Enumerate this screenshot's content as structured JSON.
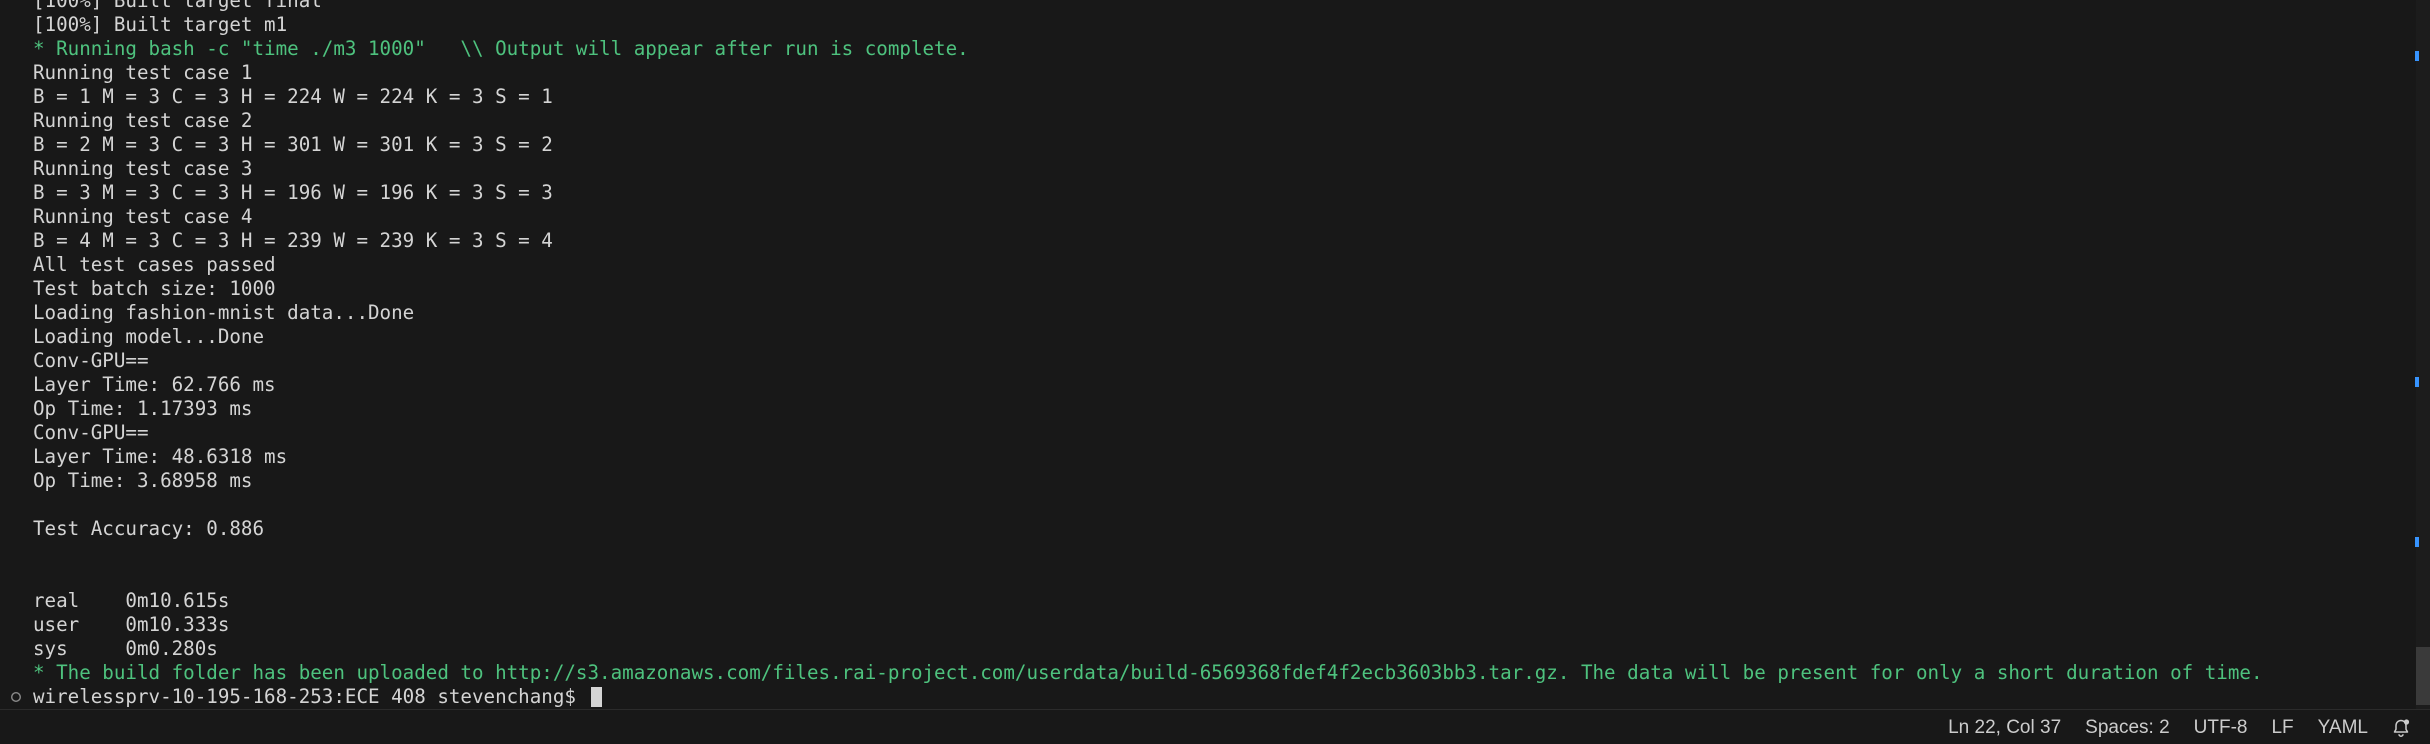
{
  "terminal": {
    "lines": [
      {
        "text": "[100%] Built target final",
        "color": "default"
      },
      {
        "text": "[100%] Built target m1",
        "color": "default"
      },
      {
        "text": "* Running bash -c \"time ./m3 1000\"   \\\\ Output will appear after run is complete.",
        "color": "green"
      },
      {
        "text": "Running test case 1",
        "color": "default"
      },
      {
        "text": "B = 1 M = 3 C = 3 H = 224 W = 224 K = 3 S = 1",
        "color": "default"
      },
      {
        "text": "Running test case 2",
        "color": "default"
      },
      {
        "text": "B = 2 M = 3 C = 3 H = 301 W = 301 K = 3 S = 2",
        "color": "default"
      },
      {
        "text": "Running test case 3",
        "color": "default"
      },
      {
        "text": "B = 3 M = 3 C = 3 H = 196 W = 196 K = 3 S = 3",
        "color": "default"
      },
      {
        "text": "Running test case 4",
        "color": "default"
      },
      {
        "text": "B = 4 M = 3 C = 3 H = 239 W = 239 K = 3 S = 4",
        "color": "default"
      },
      {
        "text": "All test cases passed",
        "color": "default"
      },
      {
        "text": "Test batch size: 1000",
        "color": "default"
      },
      {
        "text": "Loading fashion-mnist data...Done",
        "color": "default"
      },
      {
        "text": "Loading model...Done",
        "color": "default"
      },
      {
        "text": "Conv-GPU==",
        "color": "default"
      },
      {
        "text": "Layer Time: 62.766 ms",
        "color": "default"
      },
      {
        "text": "Op Time: 1.17393 ms",
        "color": "default"
      },
      {
        "text": "Conv-GPU==",
        "color": "default"
      },
      {
        "text": "Layer Time: 48.6318 ms",
        "color": "default"
      },
      {
        "text": "Op Time: 3.68958 ms",
        "color": "default"
      },
      {
        "text": "",
        "color": "default"
      },
      {
        "text": "Test Accuracy: 0.886",
        "color": "default"
      },
      {
        "text": "",
        "color": "default"
      },
      {
        "text": "",
        "color": "default"
      },
      {
        "text": "real    0m10.615s",
        "color": "default"
      },
      {
        "text": "user    0m10.333s",
        "color": "default"
      },
      {
        "text": "sys     0m0.280s",
        "color": "default"
      },
      {
        "text": "* The build folder has been uploaded to http://s3.amazonaws.com/files.rai-project.com/userdata/build-6569368fdef4f2ecb3603bb3.tar.gz. The data will be present for only a short duration of time.",
        "color": "green"
      }
    ],
    "prompt": "wirelessprv-10-195-168-253:ECE 408 stevenchang$ ",
    "prompt_marker_icon": "circle-outline-icon",
    "colors": {
      "background": "#181818",
      "text": "#d4d4d4",
      "green": "#4ec27e",
      "overview_marker": "#3794ff"
    }
  },
  "status_bar": {
    "cursor_position": "Ln 22, Col 37",
    "indentation": "Spaces: 2",
    "encoding": "UTF-8",
    "line_ending": "LF",
    "language": "YAML",
    "notification_icon": "bell-icon"
  }
}
